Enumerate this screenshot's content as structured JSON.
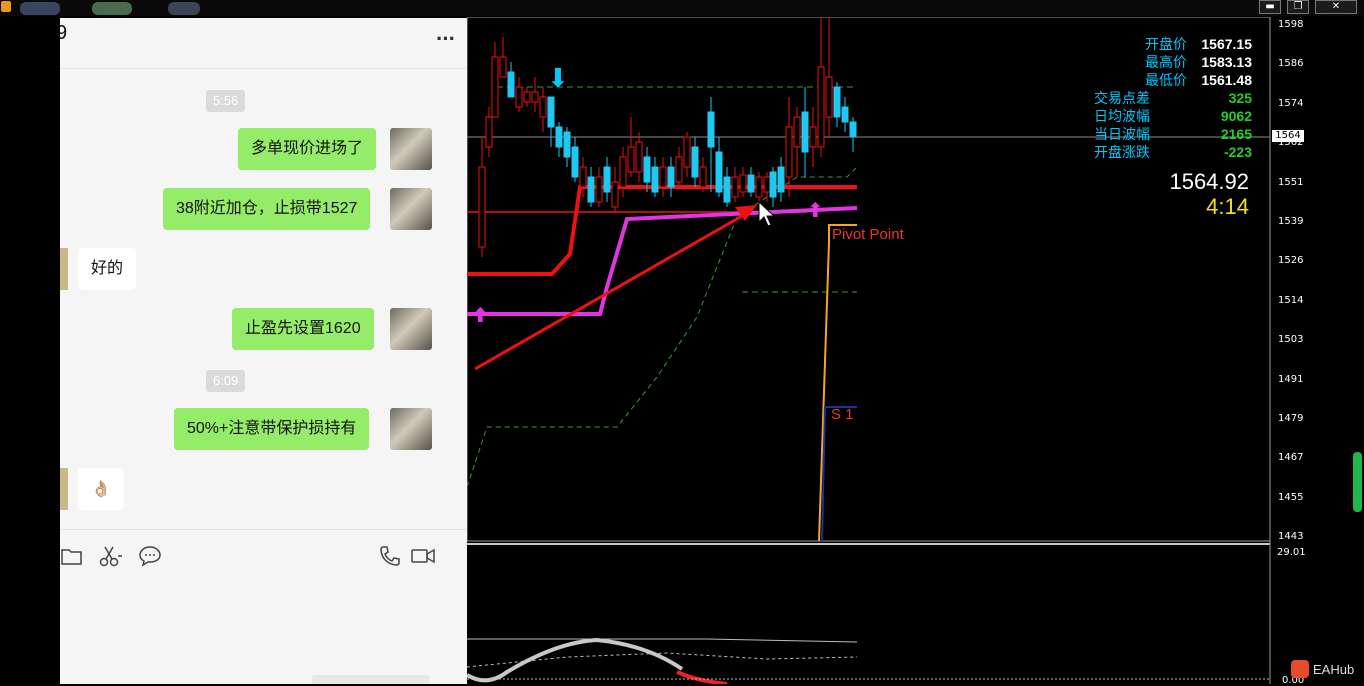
{
  "window": {
    "min_label": "▬",
    "max_label": "❐",
    "close_label": "✕"
  },
  "chat": {
    "title_fragment": "9",
    "more_label": "···",
    "messages": [
      {
        "type": "time",
        "text": "5:56"
      },
      {
        "type": "sent",
        "text": "多单现价进场了"
      },
      {
        "type": "sent",
        "text": "38附近加仓，止损带1527"
      },
      {
        "type": "received",
        "text": "好的"
      },
      {
        "type": "sent",
        "text": "止盈先设置1620"
      },
      {
        "type": "time",
        "text": "6:09"
      },
      {
        "type": "sent",
        "text": "50%+注意带保护损持有"
      },
      {
        "type": "received",
        "text": "👌🏼"
      }
    ],
    "toolbar_icons": [
      "folder-icon",
      "scissors-icon",
      "chat-bubble-icon",
      "phone-icon",
      "video-icon"
    ]
  },
  "chart": {
    "info": [
      {
        "label": "开盘价",
        "value": "1567.15",
        "color": "#ffffff"
      },
      {
        "label": "最高价",
        "value": "1583.13",
        "color": "#ffffff"
      },
      {
        "label": "最低价",
        "value": "1561.48",
        "color": "#ffffff"
      },
      {
        "label": "交易点差",
        "value": "325",
        "color": "#21d121"
      },
      {
        "label": "日均波幅",
        "value": "9062",
        "color": "#21d121"
      },
      {
        "label": "当日波幅",
        "value": "2165",
        "color": "#21d121"
      },
      {
        "label": "开盘涨跌",
        "value": "-223",
        "color": "#21d121"
      }
    ],
    "current_price": "1564.92",
    "countdown": "4:14",
    "price_axis": [
      "1598",
      "1586",
      "1574",
      "1562",
      "1551",
      "1539",
      "1526",
      "1514",
      "1503",
      "1491",
      "1479",
      "1467",
      "1455",
      "1443"
    ],
    "price_marker": "1564",
    "pivot_label": "Pivot Point",
    "s1_label": "S 1",
    "sub_axis_top": "29.01",
    "sub_axis_bottom": "0.00",
    "watermark": "EAHub"
  }
}
